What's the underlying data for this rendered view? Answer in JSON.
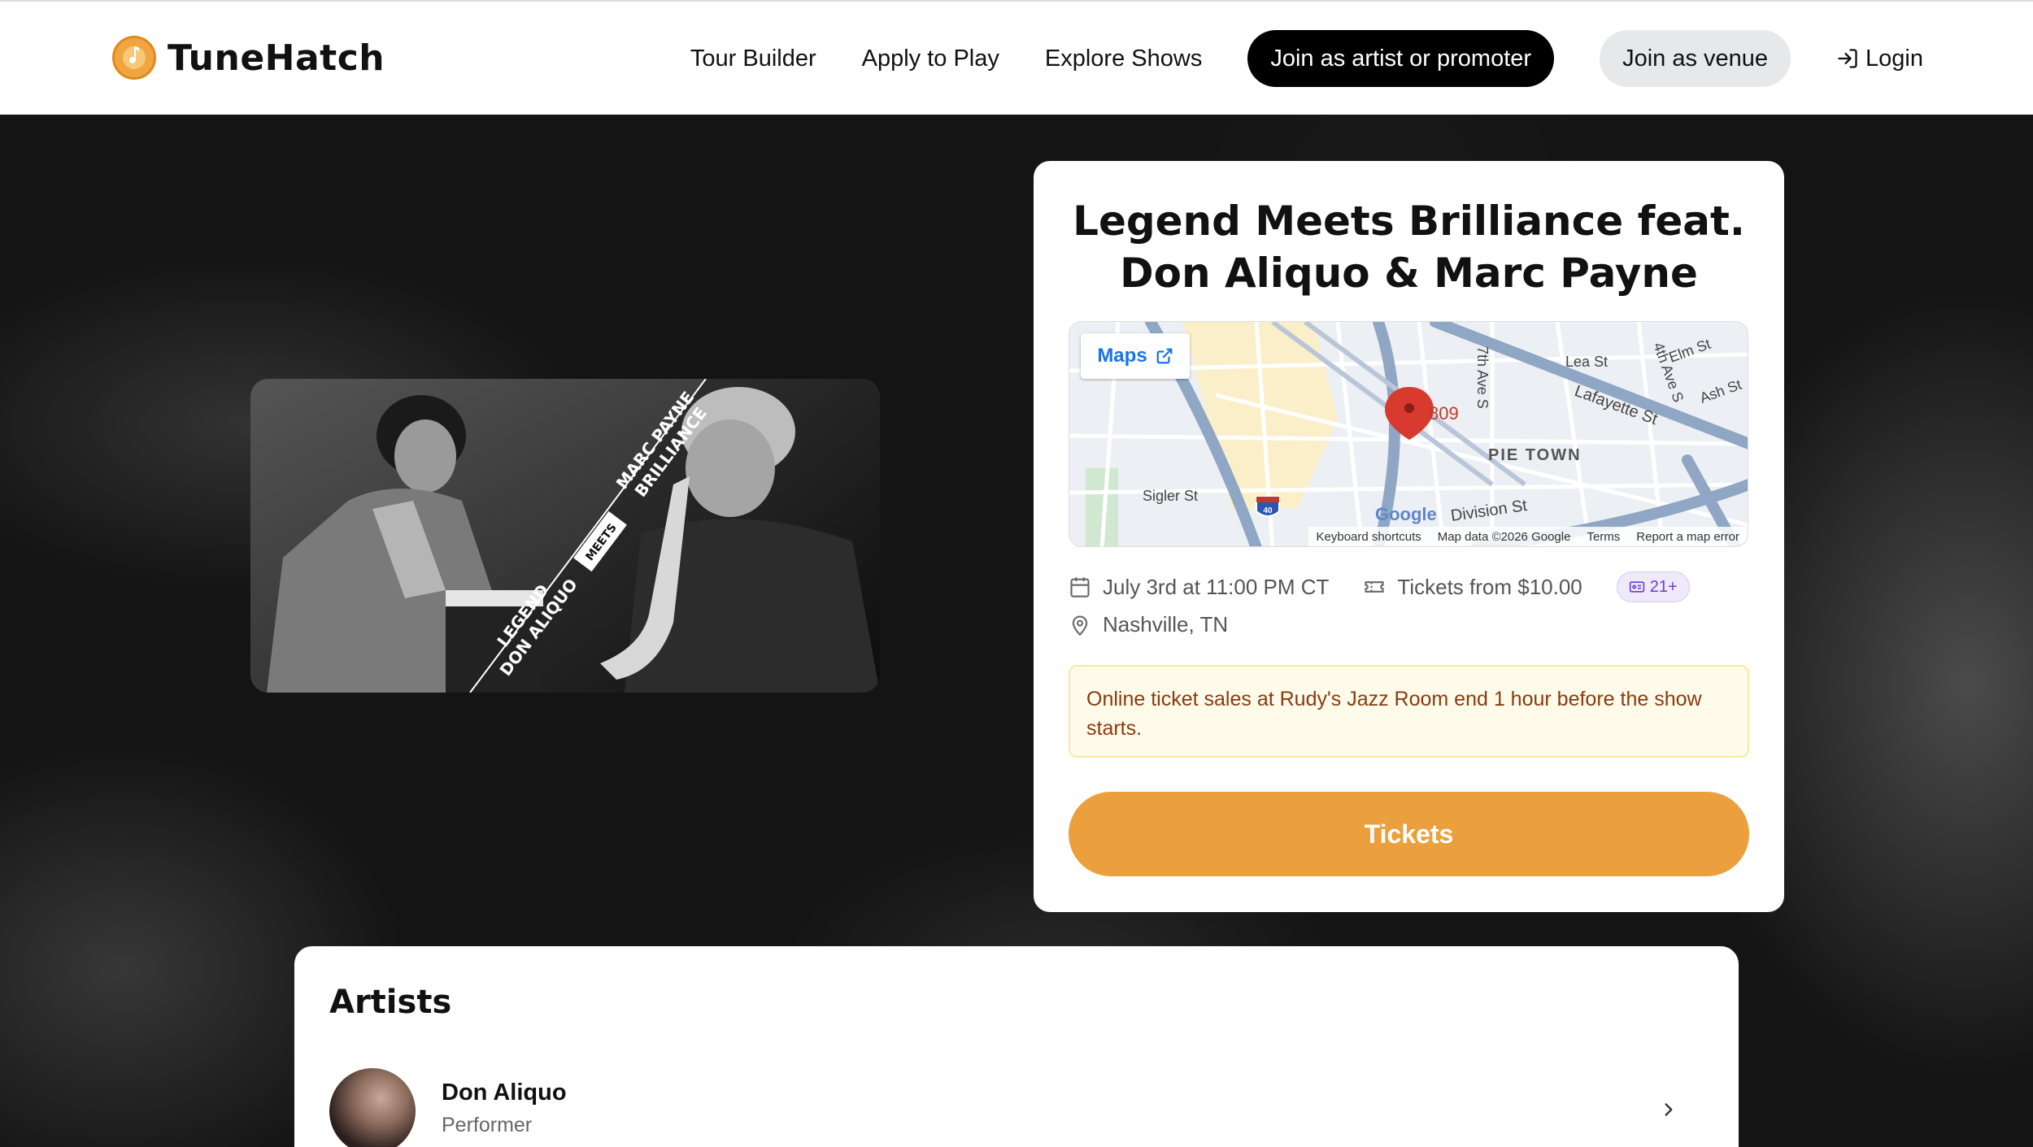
{
  "header": {
    "brand": "TuneHatch",
    "nav": [
      "Tour Builder",
      "Apply to Play",
      "Explore Shows"
    ],
    "cta_artist": "Join as artist or promoter",
    "cta_venue": "Join as venue",
    "login": "Login"
  },
  "event": {
    "image_text": [
      "MARC PAYNE",
      "BRILLIANCE",
      "MEETS",
      "LEGEND",
      "DON ALIQUO"
    ],
    "title_line1": "Legend Meets Brilliance feat.",
    "title_line2": "Don Aliquo & Marc Payne",
    "map": {
      "button": "Maps",
      "pin_label": "809",
      "labels": [
        "Lea St",
        "Elm St",
        "4th Ave S",
        "Lafayette St",
        "Ash St",
        "7th Ave S",
        "PIE TOWN",
        "Sigler St",
        "Division St",
        "40"
      ],
      "attribution": [
        "Keyboard shortcuts",
        "Map data ©2026 Google",
        "Terms",
        "Report a map error"
      ],
      "logo": "Google"
    },
    "date": "July 3rd at 11:00 PM CT",
    "price": "Tickets from $10.00",
    "age": "21+",
    "location": "Nashville, TN",
    "notice": "Online ticket sales at Rudy's Jazz Room end 1 hour before the show starts.",
    "tickets_button": "Tickets"
  },
  "artists": {
    "title": "Artists",
    "items": [
      {
        "name": "Don Aliquo",
        "role": "Performer"
      }
    ]
  },
  "colors": {
    "accent": "#eba03d",
    "notice_bg": "#fffbea",
    "notice_text": "#8a3a0e",
    "badge": "#6b3fd0"
  }
}
